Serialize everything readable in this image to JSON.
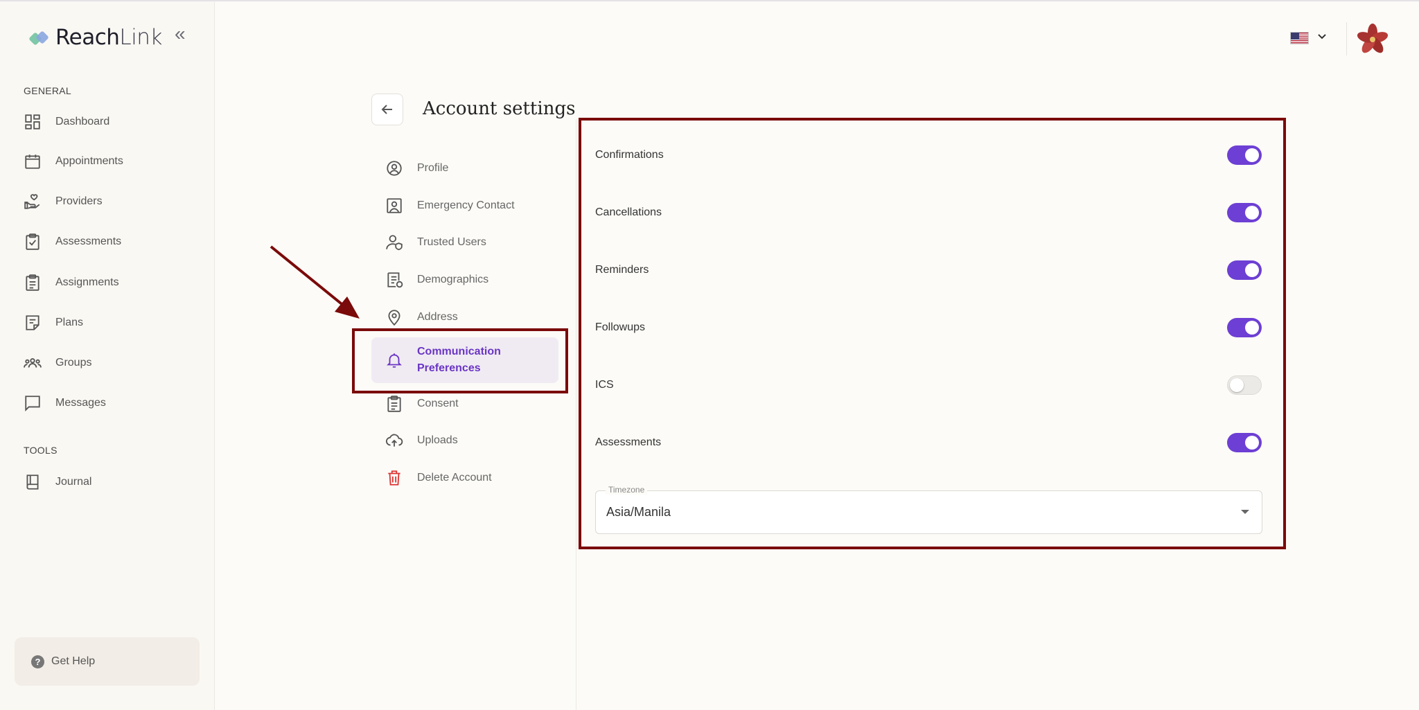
{
  "brand": {
    "name_bold": "Reach",
    "name_light": "Link"
  },
  "sidebar": {
    "general_label": "GENERAL",
    "tools_label": "TOOLS",
    "items": [
      {
        "label": "Dashboard",
        "icon": "dashboard-icon"
      },
      {
        "label": "Appointments",
        "icon": "calendar-icon"
      },
      {
        "label": "Providers",
        "icon": "hand-heart-icon"
      },
      {
        "label": "Assessments",
        "icon": "clipboard-check-icon"
      },
      {
        "label": "Assignments",
        "icon": "clipboard-list-icon"
      },
      {
        "label": "Plans",
        "icon": "note-icon"
      },
      {
        "label": "Groups",
        "icon": "group-icon"
      },
      {
        "label": "Messages",
        "icon": "chat-icon"
      }
    ],
    "tools": [
      {
        "label": "Journal",
        "icon": "book-icon"
      }
    ],
    "help_label": "Get Help"
  },
  "header": {
    "language": "en-US",
    "flag_icon": "us-flag-icon"
  },
  "settings": {
    "title": "Account settings",
    "menu": [
      {
        "label": "Profile",
        "icon": "user-circle-icon"
      },
      {
        "label": "Emergency Contact",
        "icon": "contact-card-icon"
      },
      {
        "label": "Trusted Users",
        "icon": "user-shield-icon"
      },
      {
        "label": "Demographics",
        "icon": "document-user-icon"
      },
      {
        "label": "Address",
        "icon": "location-pin-icon"
      },
      {
        "label_line1": "Communication",
        "label_line2": "Preferences",
        "icon": "bell-icon",
        "active": true
      },
      {
        "label": "Consent",
        "icon": "clipboard-icon"
      },
      {
        "label": "Uploads",
        "icon": "cloud-upload-icon"
      },
      {
        "label": "Delete Account",
        "icon": "trash-icon",
        "danger": true
      }
    ]
  },
  "preferences": [
    {
      "label": "Confirmations",
      "enabled": true
    },
    {
      "label": "Cancellations",
      "enabled": true
    },
    {
      "label": "Reminders",
      "enabled": true
    },
    {
      "label": "Followups",
      "enabled": true
    },
    {
      "label": "ICS",
      "enabled": false
    },
    {
      "label": "Assessments",
      "enabled": true
    }
  ],
  "timezone": {
    "label": "Timezone",
    "value": "Asia/Manila"
  },
  "colors": {
    "accent": "#6d3fd4",
    "annotation": "#7b0a0a",
    "danger": "#d33333"
  }
}
